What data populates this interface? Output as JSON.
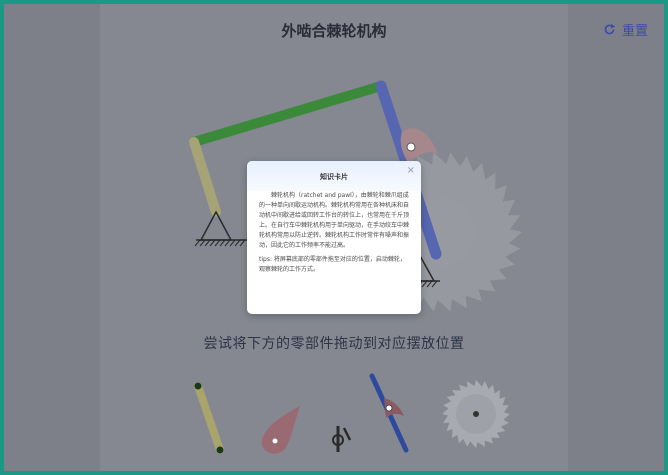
{
  "header": {
    "title": "外啮合棘轮机构",
    "reset_label": "重置",
    "reset_icon": "refresh-icon"
  },
  "instruction": "尝试将下方的零部件拖动到对应摆放位置",
  "modal": {
    "title": "知识卡片",
    "close_label": "×",
    "body": "棘轮机构（ratchet and pawl），由棘轮和棘爪组成的一种单向间歇运动机构。棘轮机构常用在各种机床和自动机中间歇进给或回转工作台的转位上，也常用在千斤顶上。在自行车中棘轮机构用于单向驱动，在手动绞车中棘轮机构常用以防止逆转。棘轮机构工作时常伴有噪声和振动，因此它的工作频率不能过高。",
    "tips": "tips: 将屏幕底部的零部件拖至对应的位置，启动棘轮，观察棘轮的工作方式。"
  },
  "parts": [
    {
      "name": "rocker-link-part",
      "color": "#c9c077"
    },
    {
      "name": "pawl-part",
      "color": "#b5707a"
    },
    {
      "name": "small-crank-part",
      "color": "#2a2a2a"
    },
    {
      "name": "blue-lever-part",
      "color": "#2d4fae"
    },
    {
      "name": "ratchet-wheel-part",
      "color": "#c9ccd4"
    }
  ],
  "colors": {
    "frame_border": "#1a9a86",
    "crank_green": "#3a8a3a",
    "rocker_yellow": "#b4b07a",
    "blue_lever": "#5b6fc2",
    "ratchet_gray": "#d7d9de",
    "accent": "#3d4aa8"
  }
}
